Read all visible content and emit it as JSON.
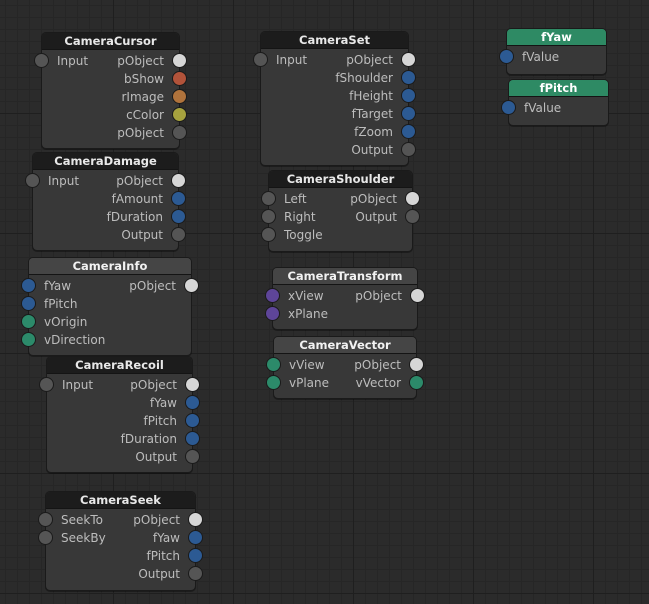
{
  "colors": {
    "white": "#d6d6d6",
    "gray": "#555555",
    "blue": "#2c5a93",
    "green": "#2c8a6a",
    "purple": "#5e4599",
    "orange_red": "#b2533a",
    "orange": "#b0733c",
    "olive": "#a6a23e"
  },
  "nodes": [
    {
      "id": "camera-cursor",
      "title": "CameraCursor",
      "style": "dark",
      "inputs": [
        {
          "label": "Input",
          "color": "gray"
        }
      ],
      "outputs": [
        {
          "label": "pObject",
          "color": "white"
        },
        {
          "label": "bShow",
          "color": "orange_red"
        },
        {
          "label": "rImage",
          "color": "orange"
        },
        {
          "label": "cColor",
          "color": "olive"
        },
        {
          "label": "pObject",
          "color": "gray"
        }
      ]
    },
    {
      "id": "camera-damage",
      "title": "CameraDamage",
      "style": "dark",
      "inputs": [
        {
          "label": "Input",
          "color": "gray"
        }
      ],
      "outputs": [
        {
          "label": "pObject",
          "color": "white"
        },
        {
          "label": "fAmount",
          "color": "blue"
        },
        {
          "label": "fDuration",
          "color": "blue"
        },
        {
          "label": "Output",
          "color": "gray"
        }
      ]
    },
    {
      "id": "camera-info",
      "title": "CameraInfo",
      "style": "gray",
      "inputs": [
        {
          "label": "fYaw",
          "color": "blue"
        },
        {
          "label": "fPitch",
          "color": "blue"
        },
        {
          "label": "vOrigin",
          "color": "green"
        },
        {
          "label": "vDirection",
          "color": "green"
        }
      ],
      "outputs": [
        {
          "label": "pObject",
          "color": "white"
        }
      ]
    },
    {
      "id": "camera-recoil",
      "title": "CameraRecoil",
      "style": "dark",
      "inputs": [
        {
          "label": "Input",
          "color": "gray"
        }
      ],
      "outputs": [
        {
          "label": "pObject",
          "color": "white"
        },
        {
          "label": "fYaw",
          "color": "blue"
        },
        {
          "label": "fPitch",
          "color": "blue"
        },
        {
          "label": "fDuration",
          "color": "blue"
        },
        {
          "label": "Output",
          "color": "gray"
        }
      ]
    },
    {
      "id": "camera-seek",
      "title": "CameraSeek",
      "style": "dark",
      "inputs": [
        {
          "label": "SeekTo",
          "color": "gray"
        },
        {
          "label": "SeekBy",
          "color": "gray"
        }
      ],
      "outputs": [
        {
          "label": "pObject",
          "color": "white"
        },
        {
          "label": "fYaw",
          "color": "blue"
        },
        {
          "label": "fPitch",
          "color": "blue"
        },
        {
          "label": "Output",
          "color": "gray"
        }
      ]
    },
    {
      "id": "camera-set",
      "title": "CameraSet",
      "style": "dark",
      "inputs": [
        {
          "label": "Input",
          "color": "gray"
        }
      ],
      "outputs": [
        {
          "label": "pObject",
          "color": "white"
        },
        {
          "label": "fShoulder",
          "color": "blue"
        },
        {
          "label": "fHeight",
          "color": "blue"
        },
        {
          "label": "fTarget",
          "color": "blue"
        },
        {
          "label": "fZoom",
          "color": "blue"
        },
        {
          "label": "Output",
          "color": "gray"
        }
      ]
    },
    {
      "id": "camera-shoulder",
      "title": "CameraShoulder",
      "style": "dark",
      "inputs": [
        {
          "label": "Left",
          "color": "gray"
        },
        {
          "label": "Right",
          "color": "gray"
        },
        {
          "label": "Toggle",
          "color": "gray"
        }
      ],
      "outputs": [
        {
          "label": "pObject",
          "color": "white"
        },
        {
          "label": "Output",
          "color": "gray"
        }
      ]
    },
    {
      "id": "camera-transform",
      "title": "CameraTransform",
      "style": "gray",
      "inputs": [
        {
          "label": "xView",
          "color": "purple"
        },
        {
          "label": "xPlane",
          "color": "purple"
        }
      ],
      "outputs": [
        {
          "label": "pObject",
          "color": "white"
        }
      ]
    },
    {
      "id": "camera-vector",
      "title": "CameraVector",
      "style": "gray",
      "inputs": [
        {
          "label": "vView",
          "color": "green"
        },
        {
          "label": "vPlane",
          "color": "green"
        }
      ],
      "outputs": [
        {
          "label": "pObject",
          "color": "white"
        },
        {
          "label": "vVector",
          "color": "green"
        }
      ]
    },
    {
      "id": "fyaw",
      "title": "fYaw",
      "style": "green",
      "inputs": [
        {
          "label": "fValue",
          "color": "blue"
        }
      ],
      "outputs": []
    },
    {
      "id": "fpitch",
      "title": "fPitch",
      "style": "green",
      "inputs": [
        {
          "label": "fValue",
          "color": "blue"
        }
      ],
      "outputs": []
    }
  ]
}
